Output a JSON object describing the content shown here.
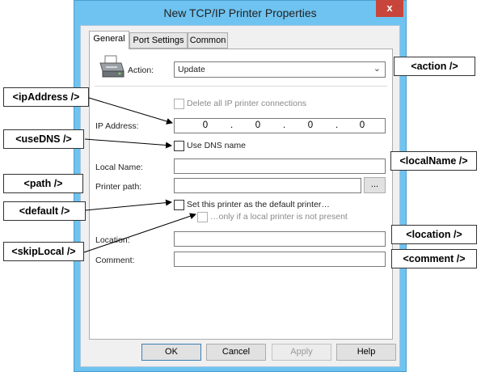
{
  "window": {
    "title": "New TCP/IP Printer Properties",
    "close_glyph": "x"
  },
  "tabs": [
    {
      "label": "General"
    },
    {
      "label": "Port Settings"
    },
    {
      "label": "Common"
    }
  ],
  "form": {
    "action_label": "Action:",
    "action_value": "Update",
    "delete_all_label": "Delete all IP printer connections",
    "ip_label": "IP Address:",
    "ip_octets": [
      "0",
      "0",
      "0",
      "0"
    ],
    "use_dns_label": "Use DNS name",
    "local_name_label": "Local Name:",
    "printer_path_label": "Printer path:",
    "browse_label": "...",
    "default_label": "Set this printer as the default printer…",
    "only_if_label": "…only if a local printer is not present",
    "location_label": "Location:",
    "comment_label": "Comment:"
  },
  "buttons": {
    "ok": "OK",
    "cancel": "Cancel",
    "apply": "Apply",
    "help": "Help"
  },
  "annotations": {
    "action": "<action />",
    "ipAddress": "<ipAddress />",
    "useDNS": "<useDNS />",
    "localName": "<localName />",
    "path": "<path />",
    "default": "<default />",
    "location": "<location />",
    "skipLocal": "<skipLocal />",
    "comment": "<comment />"
  }
}
